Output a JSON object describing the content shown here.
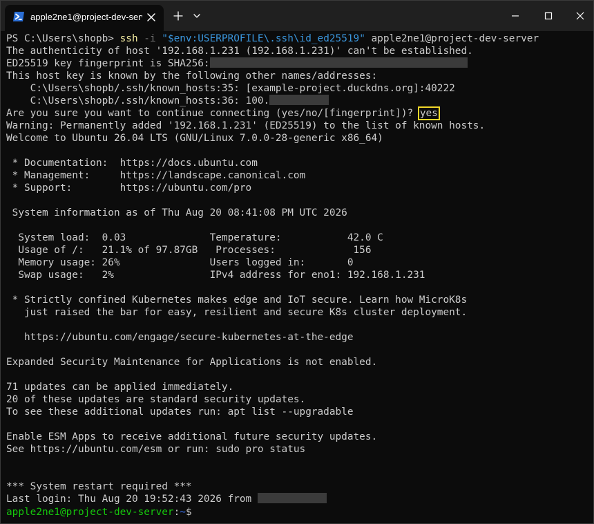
{
  "window": {
    "tab_title": "apple2ne1@project-dev-serve",
    "new_tab": "+",
    "dropdown": "⌄"
  },
  "colors": {
    "background": "#0c0c0c",
    "titlebar": "#202020",
    "text": "#cccccc",
    "command": "#f9f1a5",
    "string": "#3a96dd",
    "prompt_user": "#16c60c",
    "prompt_path": "#3b78ff",
    "highlight": "#f2d82a"
  },
  "terminal": {
    "ps_prompt": "PS C:\\Users\\shopb> ",
    "cmd_name": "ssh",
    "cmd_flag": " -i ",
    "cmd_keypath": "\"$env:USERPROFILE\\.ssh\\id_ed25519\"",
    "cmd_host": " apple2ne1@project-dev-server",
    "l_authenticity": "The authenticity of host '192.168.1.231 (192.168.1.231)' can't be established.",
    "l_fingerprint": "ED25519 key fingerprint is SHA256:",
    "l_known_by": "This host key is known by the following other names/addresses:",
    "l_known1": "    C:\\Users\\shopb/.ssh/known_hosts:35: [example-project.duckdns.org]:40222",
    "l_known2": "    C:\\Users\\shopb/.ssh/known_hosts:36: 100.",
    "l_continue": "Are you sure you want to continue connecting (yes/no/[fingerprint])? ",
    "l_yes": "yes",
    "l_warning": "Warning: Permanently added '192.168.1.231' (ED25519) to the list of known hosts.",
    "l_welcome": "Welcome to Ubuntu 26.04 LTS (GNU/Linux 7.0.0-28-generic x86_64)",
    "l_doc": " * Documentation:  https://docs.ubuntu.com",
    "l_mgmt": " * Management:     https://landscape.canonical.com",
    "l_support": " * Support:        https://ubuntu.com/pro",
    "l_sysinfo": " System information as of Thu Aug 20 08:41:08 PM UTC 2026",
    "l_stats1": "  System load:  0.03              Temperature:           42.0 C",
    "l_stats2": "  Usage of /:   21.1% of 97.87GB   Processes:             156",
    "l_stats3": "  Memory usage: 26%               Users logged in:       0",
    "l_stats4": "  Swap usage:   2%                IPv4 address for eno1: 192.168.1.231",
    "l_k8s1": " * Strictly confined Kubernetes makes edge and IoT secure. Learn how MicroK8s",
    "l_k8s2": "   just raised the bar for easy, resilient and secure K8s cluster deployment.",
    "l_k8s_url": "   https://ubuntu.com/engage/secure-kubernetes-at-the-edge",
    "l_esm": "Expanded Security Maintenance for Applications is not enabled.",
    "l_updates1": "71 updates can be applied immediately.",
    "l_updates2": "20 of these updates are standard security updates.",
    "l_updates3": "To see these additional updates run: apt list --upgradable",
    "l_esm_apps1": "Enable ESM Apps to receive additional future security updates.",
    "l_esm_apps2": "See https://ubuntu.com/esm or run: sudo pro status",
    "l_restart": "*** System restart required ***",
    "l_lastlogin": "Last login: Thu Aug 20 19:52:43 2026 from ",
    "prompt_user": "apple2ne1@project-dev-server",
    "prompt_sep": ":",
    "prompt_path": "~",
    "prompt_dollar": "$"
  }
}
